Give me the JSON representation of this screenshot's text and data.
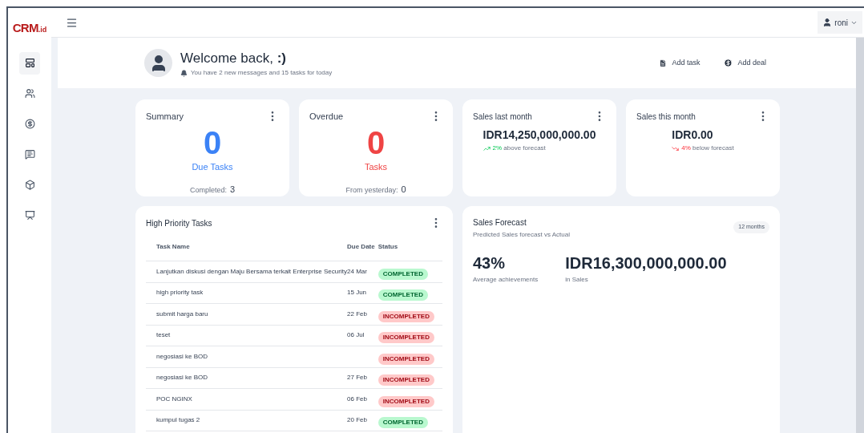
{
  "logo": {
    "main": "CRM",
    "suffix": ".id"
  },
  "sidebar": {
    "items": [
      {
        "selected": true
      },
      {
        "selected": false
      },
      {
        "selected": false
      },
      {
        "selected": false
      },
      {
        "selected": false
      },
      {
        "selected": false
      }
    ]
  },
  "user_menu": {
    "name": "roni"
  },
  "welcome": {
    "title": "Welcome back, **:)**",
    "subtitle": "You have 2 new messages and 15 tasks for today",
    "actions": [
      {
        "kind": "task",
        "label": "Add task"
      },
      {
        "kind": "deal",
        "label": "Add deal"
      }
    ]
  },
  "summary": {
    "title": "Summary",
    "value": "0",
    "label": "Due Tasks",
    "footer_label": "Completed:",
    "footer_value": "3"
  },
  "overdue": {
    "title": "Overdue",
    "value": "0",
    "label": "Tasks",
    "footer_label": "From yesterday:",
    "footer_value": "0"
  },
  "sales_cards": [
    {
      "title": "Sales last month",
      "amount": "IDR14,250,000,000.00",
      "kind": "up",
      "percent": "2%",
      "note": "above forecast"
    },
    {
      "title": "Sales this month",
      "amount": "IDR0.00",
      "kind": "down",
      "percent": "4%",
      "note": "below forecast"
    }
  ],
  "high_priority_tasks": {
    "title": "High Priority Tasks",
    "columns": [
      "Task Name",
      "Due Date",
      "Status"
    ],
    "rows": [
      {
        "name": "Lanjutkan diskusi dengan Maju Bersama terkait Enterprise Security",
        "due": "24 Mar",
        "status": "COMPLETED",
        "kind": "completed"
      },
      {
        "name": "high priority task",
        "due": "15 Jun",
        "status": "COMPLETED",
        "kind": "completed"
      },
      {
        "name": "submit harga baru",
        "due": "22 Feb",
        "status": "INCOMPLETED",
        "kind": "incompleted"
      },
      {
        "name": "teset",
        "due": "06 Jul",
        "status": "INCOMPLETED",
        "kind": "incompleted"
      },
      {
        "name": "negosiasi ke BOD",
        "status": "INCOMPLETED",
        "kind": "incompleted"
      },
      {
        "name": "negosiasi ke BOD",
        "due": "27 Feb",
        "status": "INCOMPLETED",
        "kind": "incompleted"
      },
      {
        "name": "POC NGINX",
        "due": "06 Feb",
        "status": "INCOMPLETED",
        "kind": "incompleted"
      },
      {
        "name": "kumpul tugas 2",
        "due": "20 Feb",
        "status": "COMPLETED",
        "kind": "completed"
      }
    ]
  },
  "sales_forecast": {
    "title": "Sales Forecast",
    "subtitle": "Predicted Sales forecast vs Actual",
    "period": "12 months",
    "stats": [
      {
        "value": "43%",
        "label": "Average achievements"
      },
      {
        "value": "IDR16,300,000,000.00",
        "label": "in Sales"
      }
    ]
  }
}
